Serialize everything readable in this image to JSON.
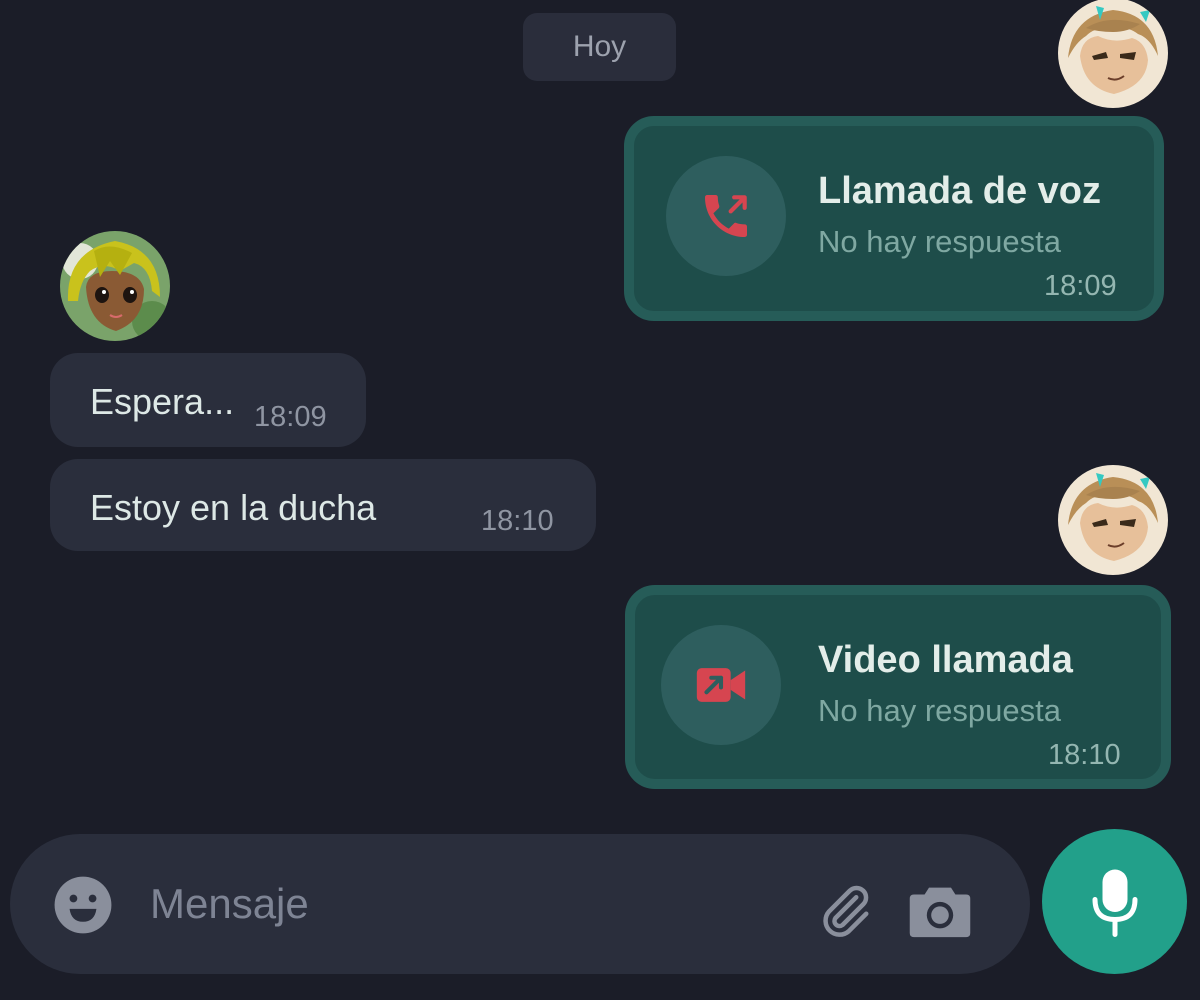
{
  "date_chip": "Hoy",
  "messages": {
    "voice_call": {
      "title": "Llamada de voz",
      "status": "No hay respuesta",
      "time": "18:09",
      "icon": "outgoing-call-icon"
    },
    "incoming": [
      {
        "text": "Espera...",
        "time": "18:09"
      },
      {
        "text": "Estoy en la ducha",
        "time": "18:10"
      }
    ],
    "video_call": {
      "title": "Video llamada",
      "status": "No hay respuesta",
      "time": "18:10",
      "icon": "outgoing-video-call-icon"
    }
  },
  "composer": {
    "placeholder": "Mensaje",
    "value": "",
    "icons": [
      "emoji-icon",
      "paperclip-icon",
      "camera-icon",
      "microphone-icon"
    ]
  },
  "colors": {
    "background": "#1b1d28",
    "outgoing_bubble": "#1e4d4a",
    "incoming_bubble": "#2a2e3c",
    "missed_call_red": "#d64550",
    "mic_button": "#22a08a"
  }
}
